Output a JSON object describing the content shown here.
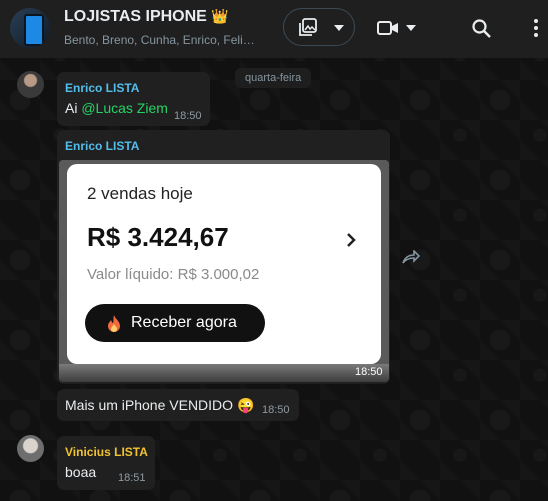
{
  "header": {
    "title": "LOJISTAS IPHONE",
    "crown": "👑",
    "subtitle": "Bento, Breno, Cunha, Enrico, Feli…"
  },
  "date_chip": "quarta-feira",
  "messages": [
    {
      "sender": "Enrico LISTA",
      "sender_color": "#53bdeb",
      "prefix": "Ai ",
      "mention": "@Lucas Ziem",
      "time": "18:50"
    },
    {
      "sender": "Enrico LISTA",
      "sender_color": "#53bdeb",
      "image": {
        "sales_title": "2 vendas hoje",
        "amount": "R$ 3.424,67",
        "net": "Valor líquido: R$ 3.000,02",
        "button": "Receber agora"
      },
      "time": "18:50"
    },
    {
      "text": "Mais um iPhone VENDIDO",
      "emoji": "😜",
      "time": "18:50"
    },
    {
      "sender": "Vinicius LISTA",
      "sender_color": "#f2c230",
      "text": "boaa",
      "time": "18:51"
    }
  ],
  "colors": {
    "header_bg": "#1f1f1f",
    "bubble_bg": "#202020",
    "mention": "#25d366"
  },
  "icons": [
    "group-avatar",
    "video-call-icon",
    "search-icon",
    "menu-icon",
    "forward-icon",
    "chevron-right-icon",
    "fire-icon"
  ]
}
